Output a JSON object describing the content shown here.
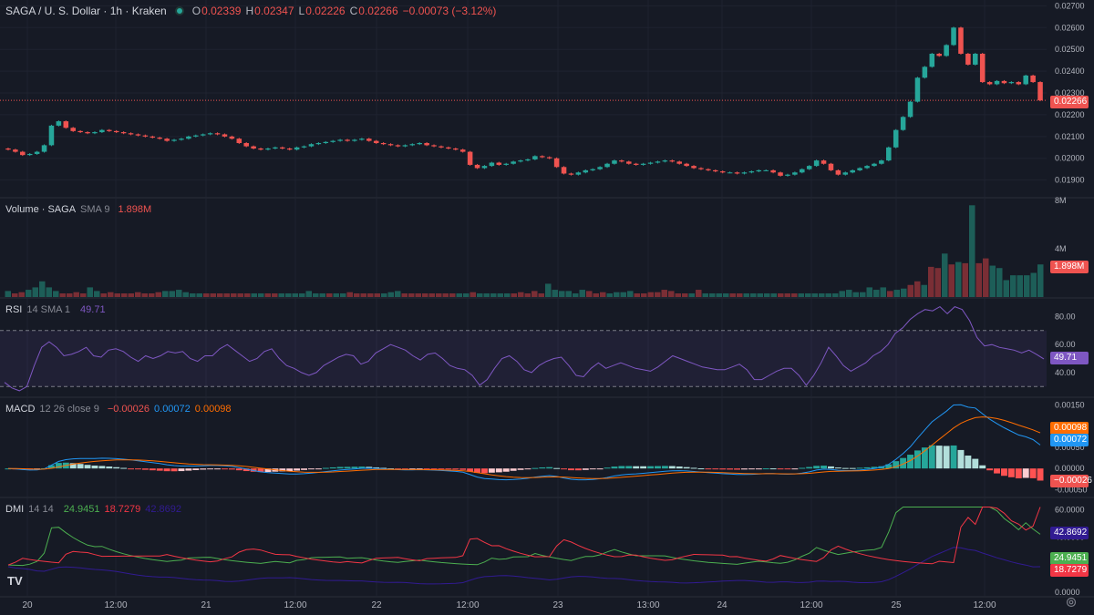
{
  "header": {
    "symbol": "SAGA / U. S. Dollar · 1h · Kraken",
    "ohlc": [
      {
        "key": "O",
        "value": "0.02339"
      },
      {
        "key": "H",
        "value": "0.02347"
      },
      {
        "key": "L",
        "value": "0.02226"
      },
      {
        "key": "C",
        "value": "0.02266"
      }
    ],
    "change": "−0.00073 (−3.12%)"
  },
  "colors": {
    "background": "#161a25",
    "up": "#26a69a",
    "down": "#ef5350",
    "rsi": "#7e57c2",
    "macd": "#2196f3",
    "signal": "#ff6d00",
    "di_plus": "#4caf50",
    "di_minus": "#f23645",
    "adx": "#311b92"
  },
  "panes": {
    "volume": {
      "label": "Volume · SAGA",
      "params": "SMA 9",
      "value": "1.898M",
      "badge": "1.898M"
    },
    "rsi": {
      "label": "RSI",
      "params": "14 SMA 1",
      "value": "49.71",
      "badge": "49.71"
    },
    "macd": {
      "label": "MACD",
      "params": "12 26 close 9",
      "macd": "−0.00026",
      "signal_value": "0.00072",
      "hist": "0.00098",
      "badge_hist": "0.00098",
      "badge_signal": "0.00072",
      "badge_macd": "−0.00026"
    },
    "dmi": {
      "label": "DMI",
      "params": "14 14",
      "plus": "24.9451",
      "minus": "18.7279",
      "adx_value": "42.8692",
      "badge_adx": "42.8692",
      "badge_plus": "24.9451",
      "badge_minus": "18.7279"
    }
  },
  "price_badge": "0.02266",
  "icons": {
    "logo": "tradingview-logo-icon",
    "settings": "gear-icon",
    "status": "market-open-dot-icon"
  },
  "chart_data": [
    {
      "type": "candlestick",
      "title": "SAGA / U. S. Dollar · 1h · Kraken",
      "x_ticks": [
        "20",
        "12:00",
        "21",
        "12:00",
        "22",
        "12:00",
        "23",
        "13:00",
        "24",
        "12:00",
        "25",
        "12:00"
      ],
      "y_ticks": [
        "0.02700",
        "0.02600",
        "0.02500",
        "0.02400",
        "0.02300",
        "0.02200",
        "0.02100",
        "0.02000",
        "0.01900"
      ],
      "ylim": [
        0.0184,
        0.0271
      ],
      "last_close": 0.02266,
      "close": [
        0.0204,
        0.0203,
        0.02015,
        0.0202,
        0.0203,
        0.0206,
        0.0215,
        0.0217,
        0.0214,
        0.02125,
        0.0212,
        0.02115,
        0.0212,
        0.0213,
        0.02125,
        0.0212,
        0.02115,
        0.0211,
        0.02105,
        0.021,
        0.02095,
        0.0209,
        0.0208,
        0.02085,
        0.0209,
        0.021,
        0.02105,
        0.0211,
        0.02115,
        0.0211,
        0.021,
        0.0209,
        0.0207,
        0.02055,
        0.02045,
        0.0204,
        0.02045,
        0.0205,
        0.02045,
        0.0204,
        0.0205,
        0.02055,
        0.02065,
        0.0207,
        0.02075,
        0.0208,
        0.02085,
        0.0208,
        0.02085,
        0.0209,
        0.0208,
        0.0207,
        0.02065,
        0.0206,
        0.02055,
        0.0206,
        0.02065,
        0.0207,
        0.0206,
        0.02055,
        0.0205,
        0.02045,
        0.0204,
        0.0203,
        0.0197,
        0.01955,
        0.01965,
        0.0198,
        0.0197,
        0.01975,
        0.01985,
        0.0199,
        0.01995,
        0.0201,
        0.02005,
        0.02,
        0.0196,
        0.0193,
        0.01925,
        0.01935,
        0.01945,
        0.0195,
        0.0196,
        0.01975,
        0.0199,
        0.01985,
        0.01975,
        0.0197,
        0.01975,
        0.0198,
        0.01985,
        0.0199,
        0.01985,
        0.01975,
        0.01965,
        0.01955,
        0.0195,
        0.01945,
        0.0194,
        0.01935,
        0.01935,
        0.0193,
        0.01935,
        0.0194,
        0.01945,
        0.01945,
        0.01935,
        0.0192,
        0.01925,
        0.01935,
        0.0195,
        0.01965,
        0.0199,
        0.01975,
        0.01945,
        0.01925,
        0.01935,
        0.01945,
        0.01955,
        0.01965,
        0.01975,
        0.0199,
        0.0205,
        0.0213,
        0.0219,
        0.0226,
        0.0237,
        0.0242,
        0.0248,
        0.0247,
        0.0252,
        0.026,
        0.0248,
        0.0243,
        0.0248,
        0.0235,
        0.0234,
        0.02355,
        0.02345,
        0.0235,
        0.0234,
        0.0238,
        0.0235,
        0.02266
      ]
    },
    {
      "type": "bar",
      "title": "Volume · SAGA",
      "y_ticks": [
        "8M",
        "4M"
      ],
      "ylim": [
        0,
        8000000
      ],
      "values": [
        0.5,
        0.3,
        0.4,
        0.6,
        0.8,
        1.3,
        0.8,
        0.5,
        0.3,
        0.3,
        0.4,
        0.3,
        0.8,
        0.5,
        0.3,
        0.4,
        0.3,
        0.3,
        0.3,
        0.4,
        0.3,
        0.3,
        0.4,
        0.5,
        0.5,
        0.6,
        0.4,
        0.3,
        0.3,
        0.3,
        0.3,
        0.3,
        0.3,
        0.3,
        0.3,
        0.3,
        0.3,
        0.3,
        0.3,
        0.3,
        0.3,
        0.3,
        0.3,
        0.3,
        0.5,
        0.3,
        0.3,
        0.3,
        0.3,
        0.3,
        0.4,
        0.3,
        0.3,
        0.3,
        0.3,
        0.3,
        0.4,
        0.5,
        0.3,
        0.3,
        0.3,
        0.3,
        0.3,
        0.3,
        0.3,
        0.3,
        0.3,
        0.3,
        0.4,
        0.3,
        0.3,
        0.3,
        0.3,
        0.3,
        0.3,
        0.4,
        0.3,
        0.5,
        0.3,
        1.1,
        0.6,
        0.5,
        0.5,
        0.3,
        0.6,
        0.5,
        0.3,
        0.4,
        0.3,
        0.4,
        0.4,
        0.5,
        0.3,
        0.3,
        0.4,
        0.4,
        0.6,
        0.5,
        0.3,
        0.3,
        0.3,
        0.6,
        0.3,
        0.3,
        0.3,
        0.3,
        0.3,
        0.3,
        0.3,
        0.3,
        0.3,
        0.3,
        0.3,
        0.3,
        0.3,
        0.3,
        0.3,
        0.3,
        0.3,
        0.3,
        0.3,
        0.3,
        0.5,
        0.6,
        0.4,
        0.4,
        0.8,
        0.6,
        0.8,
        0.5,
        0.6,
        0.7,
        1.0,
        1.3,
        1.0,
        2.5,
        2.4,
        3.6,
        2.7,
        2.9,
        2.8,
        7.6,
        2.8,
        3.2,
        2.6,
        2.4,
        1.4,
        1.8,
        1.8,
        1.8,
        2.0,
        2.7
      ],
      "values_unit": "M",
      "last_value": "1.898M"
    },
    {
      "type": "line",
      "title": "RSI",
      "y_ticks": [
        "80.00",
        "60.00",
        "40.00"
      ],
      "ylim": [
        25,
        90
      ],
      "bands": [
        30,
        70
      ],
      "values": [
        33,
        29,
        27,
        30,
        45,
        58,
        62,
        58,
        52,
        53,
        55,
        58,
        52,
        51,
        56,
        57,
        55,
        51,
        48,
        52,
        50,
        52,
        55,
        54,
        55,
        50,
        48,
        52,
        52,
        57,
        60,
        56,
        52,
        48,
        50,
        55,
        57,
        50,
        45,
        43,
        40,
        38,
        40,
        45,
        48,
        51,
        53,
        52,
        46,
        48,
        54,
        57,
        60,
        58,
        56,
        52,
        49,
        53,
        54,
        50,
        45,
        43,
        42,
        38,
        31,
        35,
        43,
        50,
        52,
        48,
        42,
        40,
        45,
        48,
        50,
        51,
        45,
        38,
        37,
        43,
        47,
        43,
        45,
        47,
        45,
        43,
        42,
        41,
        44,
        48,
        52,
        50,
        48,
        46,
        44,
        43,
        42,
        42,
        44,
        46,
        42,
        35,
        35,
        38,
        41,
        43,
        43,
        38,
        31,
        38,
        47,
        58,
        52,
        45,
        41,
        44,
        47,
        52,
        55,
        60,
        68,
        72,
        78,
        82,
        85,
        84,
        87,
        82,
        87,
        85,
        77,
        65,
        59,
        60,
        58,
        57,
        56,
        54,
        56,
        53,
        49.71
      ],
      "last_value": "49.71"
    },
    {
      "type": "line+histogram",
      "title": "MACD",
      "y_ticks": [
        "0.00150",
        "0.00100",
        "0.00050",
        "0.00000",
        "-0.00050"
      ],
      "ylim": [
        -0.0006,
        0.0016
      ],
      "series": [
        {
          "name": "MACD",
          "last": -0.00026
        },
        {
          "name": "Signal",
          "last": 0.00072
        },
        {
          "name": "Histogram",
          "last": 0.00098
        }
      ]
    },
    {
      "type": "line",
      "title": "DMI",
      "y_ticks": [
        "60.0000",
        "40.0000",
        "20.0000",
        "0.0000"
      ],
      "ylim": [
        0,
        65
      ],
      "series": [
        {
          "name": "+DI",
          "last": 24.9451
        },
        {
          "name": "−DI",
          "last": 18.7279
        },
        {
          "name": "ADX",
          "last": 42.8692
        }
      ]
    }
  ]
}
